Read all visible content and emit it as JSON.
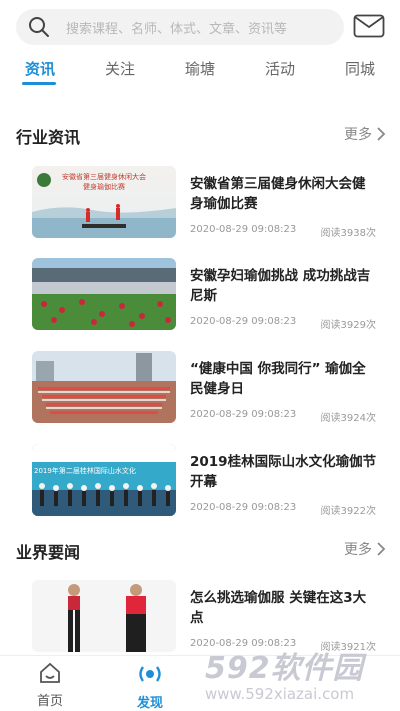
{
  "search": {
    "placeholder": "搜索课程、名师、体式、文章、资讯等"
  },
  "tabs": [
    {
      "label": "资讯",
      "active": true
    },
    {
      "label": "关注"
    },
    {
      "label": "瑜塘"
    },
    {
      "label": "活动"
    },
    {
      "label": "同城"
    }
  ],
  "sections": [
    {
      "title": "行业资讯",
      "more": "更多",
      "items": [
        {
          "title": "安徽省第三届健身休闲大会健身瑜伽比赛",
          "date": "2020-08-29 09:08:23",
          "reads": "阅读3938次",
          "thumb_caption": "安徽省第三届健身休闲大会\n健身瑜伽比赛"
        },
        {
          "title": "安徽孕妇瑜伽挑战 成功挑战吉尼斯",
          "date": "2020-08-29 09:08:23",
          "reads": "阅读3929次"
        },
        {
          "title": "“健康中国 你我同行” 瑜伽全民健身日",
          "date": "2020-08-29 09:08:23",
          "reads": "阅读3924次"
        },
        {
          "title": "2019桂林国际山水文化瑜伽节开幕",
          "date": "2020-08-29 09:08:23",
          "reads": "阅读3922次",
          "thumb_caption": "2019年第二届桂林国际山水文化"
        }
      ]
    },
    {
      "title": "业界要闻",
      "more": "更多",
      "items": [
        {
          "title": "怎么挑选瑜伽服 关键在这3大点",
          "date": "2020-08-29 09:08:23",
          "reads": "阅读3921次"
        }
      ]
    }
  ],
  "bottom_nav": [
    {
      "label": "首页",
      "icon": "home-icon"
    },
    {
      "label": "发现",
      "icon": "discover-icon",
      "active": true
    }
  ],
  "watermark": {
    "logo": "592软件园",
    "url": "www.592xiazai.com"
  },
  "colors": {
    "accent": "#1e8fd6",
    "text": "#222222",
    "muted": "#999999",
    "search_bg": "#f2f2f2"
  }
}
